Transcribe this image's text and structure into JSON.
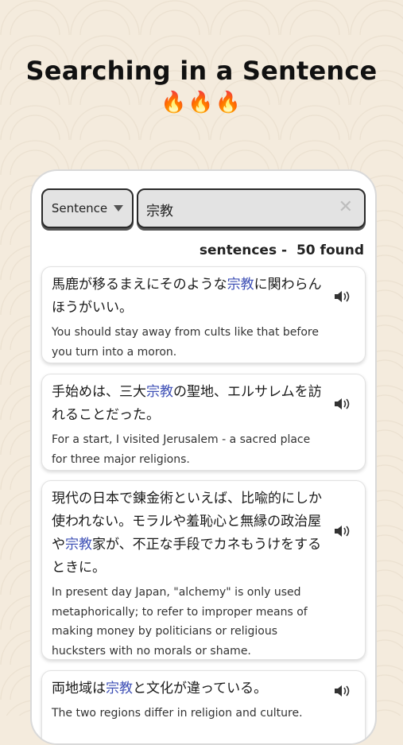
{
  "headline": "Searching in a Sentence",
  "fires": "🔥🔥🔥",
  "search": {
    "mode": "Sentence",
    "query": "宗教",
    "clear": "✕"
  },
  "results_header": {
    "label": "sentences -",
    "count": "50 found"
  },
  "results": [
    {
      "jp_parts": [
        "馬鹿が移るまえにそのような",
        "宗教",
        "に関わらんほうがいい。"
      ],
      "en": "You should stay away from cults like that before you turn into a moron."
    },
    {
      "jp_parts": [
        "手始めは、三大",
        "宗教",
        "の聖地、エルサレムを訪れることだった。"
      ],
      "en": "For a start, I visited Jerusalem - a sacred place for three major religions."
    },
    {
      "jp_parts": [
        "現代の日本で錬金術といえば、比喩的にしか使われない。モラルや羞恥心と無縁の政治屋や",
        "宗教",
        "家が、不正な手段でカネもうけをするときに。"
      ],
      "en": "In present day Japan, \"alchemy\" is only used metaphorically; to refer to improper means of making money by politicians or religious hucksters with no morals or shame."
    },
    {
      "jp_parts": [
        "両地域は",
        "宗教",
        "と文化が違っている。"
      ],
      "en": "The two regions differ in religion and culture."
    }
  ]
}
